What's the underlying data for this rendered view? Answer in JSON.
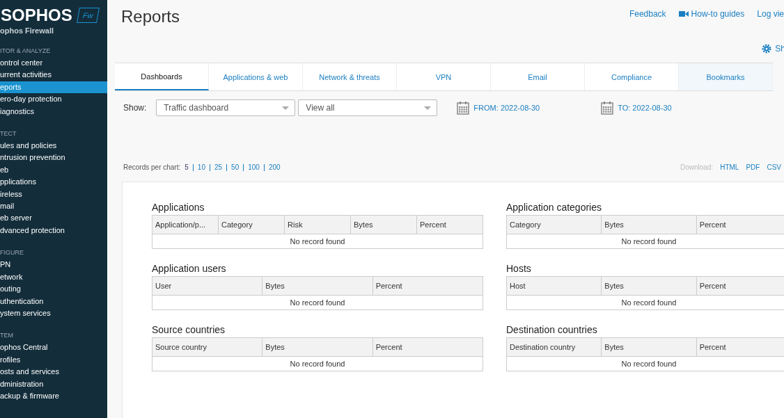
{
  "sidebar": {
    "logo": "SOPHOS",
    "logo_badge": "Fw",
    "product": "ophos Firewall",
    "sections": [
      {
        "heading": "ITOR & ANALYZE",
        "items": [
          {
            "label": "ontrol center",
            "selected": false
          },
          {
            "label": "urrent activities",
            "selected": false
          },
          {
            "label": "eports",
            "selected": true
          },
          {
            "label": "ero-day protection",
            "selected": false
          },
          {
            "label": "iagnostics",
            "selected": false
          }
        ]
      },
      {
        "heading": "TECT",
        "items": [
          {
            "label": "ules and policies",
            "selected": false
          },
          {
            "label": "ntrusion prevention",
            "selected": false
          },
          {
            "label": "eb",
            "selected": false
          },
          {
            "label": "pplications",
            "selected": false
          },
          {
            "label": "ireless",
            "selected": false
          },
          {
            "label": "mail",
            "selected": false
          },
          {
            "label": "eb server",
            "selected": false
          },
          {
            "label": "dvanced protection",
            "selected": false
          }
        ]
      },
      {
        "heading": "FIGURE",
        "items": [
          {
            "label": "PN",
            "selected": false
          },
          {
            "label": "etwork",
            "selected": false
          },
          {
            "label": "outing",
            "selected": false
          },
          {
            "label": "uthentication",
            "selected": false
          },
          {
            "label": "ystem services",
            "selected": false
          }
        ]
      },
      {
        "heading": "TEM",
        "items": [
          {
            "label": "ophos Central",
            "selected": false
          },
          {
            "label": "rofiles",
            "selected": false
          },
          {
            "label": "osts and services",
            "selected": false
          },
          {
            "label": "dministration",
            "selected": false
          },
          {
            "label": "ackup & firmware",
            "selected": false
          }
        ]
      }
    ]
  },
  "page_title": "Reports",
  "top_links": [
    {
      "label": "Feedback",
      "kind": "text"
    },
    {
      "label": "How-to guides",
      "kind": "video"
    },
    {
      "label": "Log vie",
      "kind": "text"
    }
  ],
  "settings_button": "Sh",
  "tabs": [
    {
      "label": "Dashboards",
      "selected": true
    },
    {
      "label": "Applications & web",
      "selected": false
    },
    {
      "label": "Network & threats",
      "selected": false
    },
    {
      "label": "VPN",
      "selected": false
    },
    {
      "label": "Email",
      "selected": false
    },
    {
      "label": "Compliance",
      "selected": false
    },
    {
      "label": "Bookmarks",
      "selected": false
    }
  ],
  "filters": {
    "label": "Show:",
    "dashboard": "Traffic dashboard",
    "view": "View all",
    "from_label": "FROM:",
    "from": "2022-08-30",
    "to_label": "TO:",
    "to": "2022-08-30"
  },
  "records": {
    "label": "Records per chart:",
    "options": [
      {
        "label": "5",
        "selected": true
      },
      {
        "label": "10",
        "selected": false
      },
      {
        "label": "25",
        "selected": false
      },
      {
        "label": "50",
        "selected": false
      },
      {
        "label": "100",
        "selected": false
      },
      {
        "label": "200",
        "selected": false
      }
    ]
  },
  "download": {
    "label": "Download:",
    "formats": [
      "HTML",
      "PDF",
      "CSV"
    ]
  },
  "reports": [
    {
      "title": "Applications",
      "columns": [
        "Application/p...",
        "Category",
        "Risk",
        "Bytes",
        "Percent"
      ],
      "empty": "No record found"
    },
    {
      "title": "Application categories",
      "columns": [
        "Category",
        "Bytes",
        "Percent"
      ],
      "empty": "No record found"
    },
    {
      "title": "Application users",
      "columns": [
        "User",
        "Bytes",
        "Percent"
      ],
      "empty": "No record found"
    },
    {
      "title": "Hosts",
      "columns": [
        "Host",
        "Bytes",
        "Percent"
      ],
      "empty": "No record found"
    },
    {
      "title": "Source countries",
      "columns": [
        "Source country",
        "Bytes",
        "Percent"
      ],
      "empty": "No record found"
    },
    {
      "title": "Destination countries",
      "columns": [
        "Destination country",
        "Bytes",
        "Percent"
      ],
      "empty": "No record found"
    }
  ]
}
